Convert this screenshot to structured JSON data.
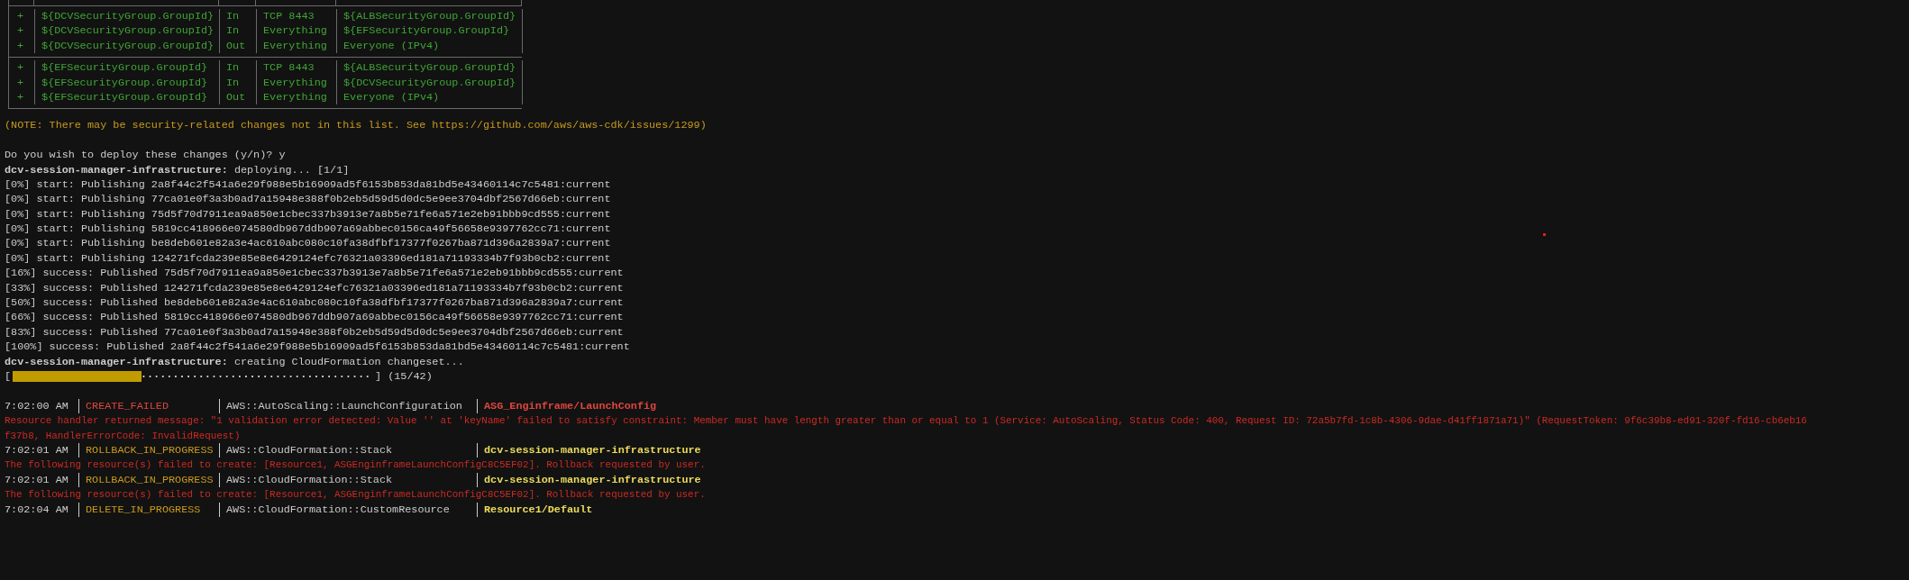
{
  "terminal": {
    "security_groups": [
      {
        "rows": [
          {
            "sign": "+",
            "group": "${DCVSecurityGroup.GroupId}",
            "direction": "In",
            "protocol": "TCP 8443",
            "peer": "${ALBSecurityGroup.GroupId}"
          },
          {
            "sign": "+",
            "group": "${DCVSecurityGroup.GroupId}",
            "direction": "In",
            "protocol": "Everything",
            "peer": "${EFSecurityGroup.GroupId}"
          },
          {
            "sign": "+",
            "group": "${DCVSecurityGroup.GroupId}",
            "direction": "Out",
            "protocol": "Everything",
            "peer": "Everyone (IPv4)"
          }
        ]
      },
      {
        "rows": [
          {
            "sign": "+",
            "group": "${EFSecurityGroup.GroupId}",
            "direction": "In",
            "protocol": "TCP 8443",
            "peer": "${ALBSecurityGroup.GroupId}"
          },
          {
            "sign": "+",
            "group": "${EFSecurityGroup.GroupId}",
            "direction": "In",
            "protocol": "Everything",
            "peer": "${DCVSecurityGroup.GroupId}"
          },
          {
            "sign": "+",
            "group": "${EFSecurityGroup.GroupId}",
            "direction": "Out",
            "protocol": "Everything",
            "peer": "Everyone (IPv4)"
          }
        ]
      }
    ],
    "note": "(NOTE: There may be security-related changes not in this list. See https://github.com/aws/aws-cdk/issues/1299)",
    "prompt": "Do you wish to deploy these changes (y/n)? y",
    "lines": [
      {
        "kind": "stack",
        "stack": "dcv-session-manager-infrastructure:",
        "text": "deploying... [1/1]"
      },
      {
        "kind": "plain",
        "text": "[0%] start: Publishing 2a8f44c2f541a6e29f988e5b16909ad5f6153b853da81bd5e43460114c7c5481:current"
      },
      {
        "kind": "plain",
        "text": "[0%] start: Publishing 77ca01e0f3a3b0ad7a15948e388f0b2eb5d59d5d0dc5e9ee3704dbf2567d66eb:current"
      },
      {
        "kind": "plain",
        "text": "[0%] start: Publishing 75d5f70d7911ea9a850e1cbec337b3913e7a8b5e71fe6a571e2eb91bbb9cd555:current"
      },
      {
        "kind": "plain",
        "text": "[0%] start: Publishing 5819cc418966e074580db967ddb907a69abbec0156ca49f56658e9397762cc71:current"
      },
      {
        "kind": "plain",
        "text": "[0%] start: Publishing be8deb601e82a3e4ac610abc080c10fa38dfbf17377f0267ba871d396a2839a7:current"
      },
      {
        "kind": "plain",
        "text": "[0%] start: Publishing 124271fcda239e85e8e6429124efc76321a03396ed181a71193334b7f93b0cb2:current"
      },
      {
        "kind": "plain",
        "text": "[16%] success: Published 75d5f70d7911ea9a850e1cbec337b3913e7a8b5e71fe6a571e2eb91bbb9cd555:current"
      },
      {
        "kind": "plain",
        "text": "[33%] success: Published 124271fcda239e85e8e6429124efc76321a03396ed181a71193334b7f93b0cb2:current"
      },
      {
        "kind": "plain",
        "text": "[50%] success: Published be8deb601e82a3e4ac610abc080c10fa38dfbf17377f0267ba871d396a2839a7:current"
      },
      {
        "kind": "plain",
        "text": "[66%] success: Published 5819cc418966e074580db967ddb907a69abbec0156ca49f56658e9397762cc71:current"
      },
      {
        "kind": "plain",
        "text": "[83%] success: Published 77ca01e0f3a3b0ad7a15948e388f0b2eb5d59d5d0dc5e9ee3704dbf2567d66eb:current"
      },
      {
        "kind": "plain",
        "text": "[100%] success: Published 2a8f44c2f541a6e29f988e5b16909ad5f6153b853da81bd5e43460114c7c5481:current"
      },
      {
        "kind": "stack",
        "stack": "dcv-session-manager-infrastructure:",
        "text": "creating CloudFormation changeset..."
      }
    ],
    "progress": {
      "open": "[",
      "close": "]",
      "level": 0.357,
      "reading": "(15/42)"
    },
    "events": [
      {
        "time": "7:02:00 AM",
        "kind": "failed",
        "status": "CREATE_FAILED",
        "type": "AWS::AutoScaling::LaunchConfiguration",
        "resource": "ASG_Enginframe/LaunchConfig",
        "messages": [
          "Resource handler returned message: \"1 validation error detected: Value '' at 'keyName' failed to satisfy constraint: Member must have length greater than or equal to 1 (Service: AutoScaling, Status Code: 400, Request ID: 72a5b7fd-1c8b-4306-9dae-d41ff1871a71)\" (RequestToken: 9f6c39b8-ed91-320f-fd16-cb6eb16",
          "f37b8, HandlerErrorCode: InvalidRequest)"
        ]
      },
      {
        "time": "7:02:01 AM",
        "kind": "progress",
        "status": "ROLLBACK_IN_PROGRESS",
        "type": "AWS::CloudFormation::Stack",
        "resource": "dcv-session-manager-infrastructure",
        "messages": [
          "The following resource(s) failed to create: [Resource1, ASGEnginframeLaunchConfigC8C5EF02]. Rollback requested by user."
        ]
      },
      {
        "time": "7:02:01 AM",
        "kind": "progress",
        "status": "ROLLBACK_IN_PROGRESS",
        "type": "AWS::CloudFormation::Stack",
        "resource": "dcv-session-manager-infrastructure",
        "messages": [
          "The following resource(s) failed to create: [Resource1, ASGEnginframeLaunchConfigC8C5EF02]. Rollback requested by user."
        ]
      },
      {
        "time": "7:02:04 AM",
        "kind": "progress",
        "status": "DELETE_IN_PROGRESS",
        "type": "AWS::CloudFormation::CustomResource",
        "resource": "Resource1/Default"
      }
    ]
  }
}
